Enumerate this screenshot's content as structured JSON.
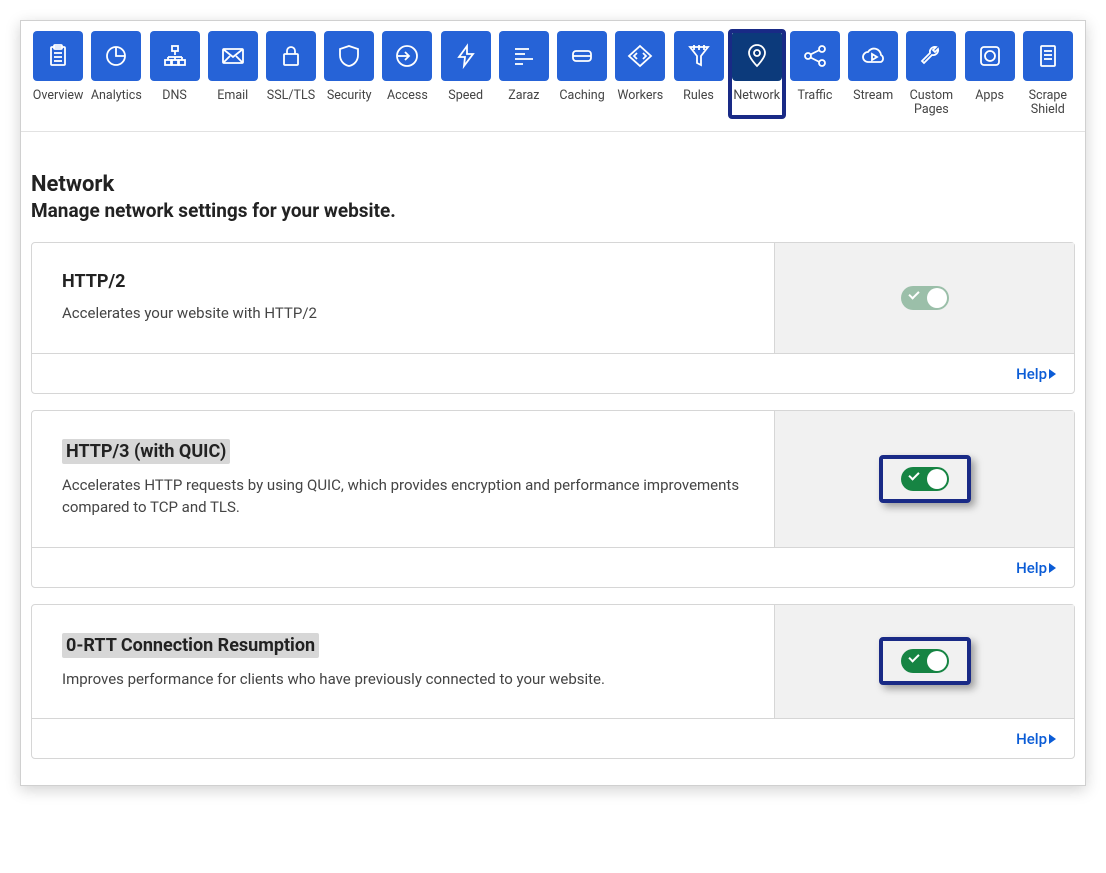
{
  "nav": {
    "items": [
      {
        "id": "overview",
        "label": "Overview",
        "icon": "clipboard-icon"
      },
      {
        "id": "analytics",
        "label": "Analytics",
        "icon": "pie-icon"
      },
      {
        "id": "dns",
        "label": "DNS",
        "icon": "sitemap-icon"
      },
      {
        "id": "email",
        "label": "Email",
        "icon": "mail-icon"
      },
      {
        "id": "ssl",
        "label": "SSL/TLS",
        "icon": "lock-icon"
      },
      {
        "id": "security",
        "label": "Security",
        "icon": "shield-icon"
      },
      {
        "id": "access",
        "label": "Access",
        "icon": "login-icon"
      },
      {
        "id": "speed",
        "label": "Speed",
        "icon": "bolt-icon"
      },
      {
        "id": "zaraz",
        "label": "Zaraz",
        "icon": "bars-icon"
      },
      {
        "id": "caching",
        "label": "Caching",
        "icon": "drive-icon"
      },
      {
        "id": "workers",
        "label": "Workers",
        "icon": "code-icon"
      },
      {
        "id": "rules",
        "label": "Rules",
        "icon": "funnel-icon"
      },
      {
        "id": "network",
        "label": "Network",
        "icon": "pin-icon",
        "selected": true
      },
      {
        "id": "traffic",
        "label": "Traffic",
        "icon": "share-icon"
      },
      {
        "id": "stream",
        "label": "Stream",
        "icon": "cloud-play-icon"
      },
      {
        "id": "custompages",
        "label": "Custom Pages",
        "icon": "wrench-icon"
      },
      {
        "id": "apps",
        "label": "Apps",
        "icon": "app-icon"
      },
      {
        "id": "scrapeshield",
        "label": "Scrape Shield",
        "icon": "doc-lines-icon"
      }
    ]
  },
  "page": {
    "title": "Network",
    "subtitle": "Manage network settings for your website.",
    "help_label": "Help"
  },
  "cards": [
    {
      "title": "HTTP/2",
      "desc": "Accelerates your website with HTTP/2",
      "toggle_on": true,
      "toggle_style": "muted",
      "highlighted_title": false,
      "highlighted_toggle": false
    },
    {
      "title": "HTTP/3 (with QUIC)",
      "desc": "Accelerates HTTP requests by using QUIC, which provides encryption and performance improvements compared to TCP and TLS.",
      "toggle_on": true,
      "toggle_style": "bold",
      "highlighted_title": true,
      "highlighted_toggle": true
    },
    {
      "title": "0-RTT Connection Resumption",
      "desc": "Improves performance for clients who have previously connected to your website.",
      "toggle_on": true,
      "toggle_style": "bold",
      "highlighted_title": true,
      "highlighted_toggle": true
    }
  ]
}
